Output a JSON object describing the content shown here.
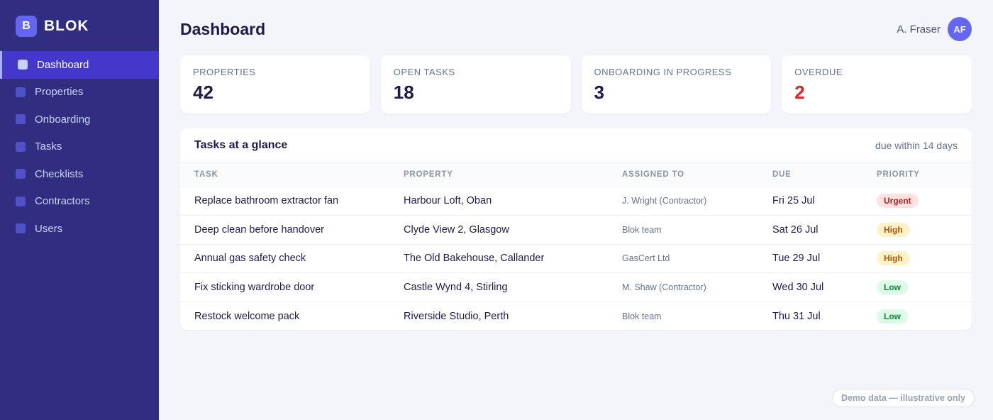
{
  "brand": {
    "logo_letter": "B",
    "name": "BLOK"
  },
  "sidebar": {
    "items": [
      {
        "label": "Dashboard",
        "active": true
      },
      {
        "label": "Properties",
        "active": false
      },
      {
        "label": "Onboarding",
        "active": false
      },
      {
        "label": "Tasks",
        "active": false
      },
      {
        "label": "Checklists",
        "active": false
      },
      {
        "label": "Contractors",
        "active": false
      },
      {
        "label": "Users",
        "active": false
      }
    ]
  },
  "header": {
    "title": "Dashboard",
    "user_name": "A. Fraser",
    "avatar_initials": "AF"
  },
  "stats": [
    {
      "label": "PROPERTIES",
      "value": "42"
    },
    {
      "label": "OPEN TASKS",
      "value": "18"
    },
    {
      "label": "ONBOARDING IN PROGRESS",
      "value": "3"
    },
    {
      "label": "OVERDUE",
      "value": "2"
    }
  ],
  "tasks_panel": {
    "title": "Tasks at a glance",
    "subtitle": "due within 14 days",
    "columns": [
      "TASK",
      "PROPERTY",
      "ASSIGNED TO",
      "DUE",
      "PRIORITY"
    ],
    "rows": [
      {
        "task": "Replace bathroom extractor fan",
        "property": "Harbour Loft, Oban",
        "assigned": "J. Wright (Contractor)",
        "due": "Fri 25 Jul",
        "priority": "Urgent"
      },
      {
        "task": "Deep clean before handover",
        "property": "Clyde View 2, Glasgow",
        "assigned": "Blok team",
        "due": "Sat 26 Jul",
        "priority": "High"
      },
      {
        "task": "Annual gas safety check",
        "property": "The Old Bakehouse, Callander",
        "assigned": "GasCert Ltd",
        "due": "Tue 29 Jul",
        "priority": "High"
      },
      {
        "task": "Fix sticking wardrobe door",
        "property": "Castle Wynd 4, Stirling",
        "assigned": "M. Shaw (Contractor)",
        "due": "Wed 30 Jul",
        "priority": "Low"
      },
      {
        "task": "Restock welcome pack",
        "property": "Riverside Studio, Perth",
        "assigned": "Blok team",
        "due": "Thu 31 Jul",
        "priority": "Low"
      }
    ]
  },
  "footer_note": "Demo data — illustrative only",
  "colors": {
    "sidebar_bg": "#312e81",
    "accent": "#6366f1",
    "overdue": "#dc2626",
    "urgent": "#b91c1c",
    "high": "#b45309",
    "low": "#15803d"
  }
}
